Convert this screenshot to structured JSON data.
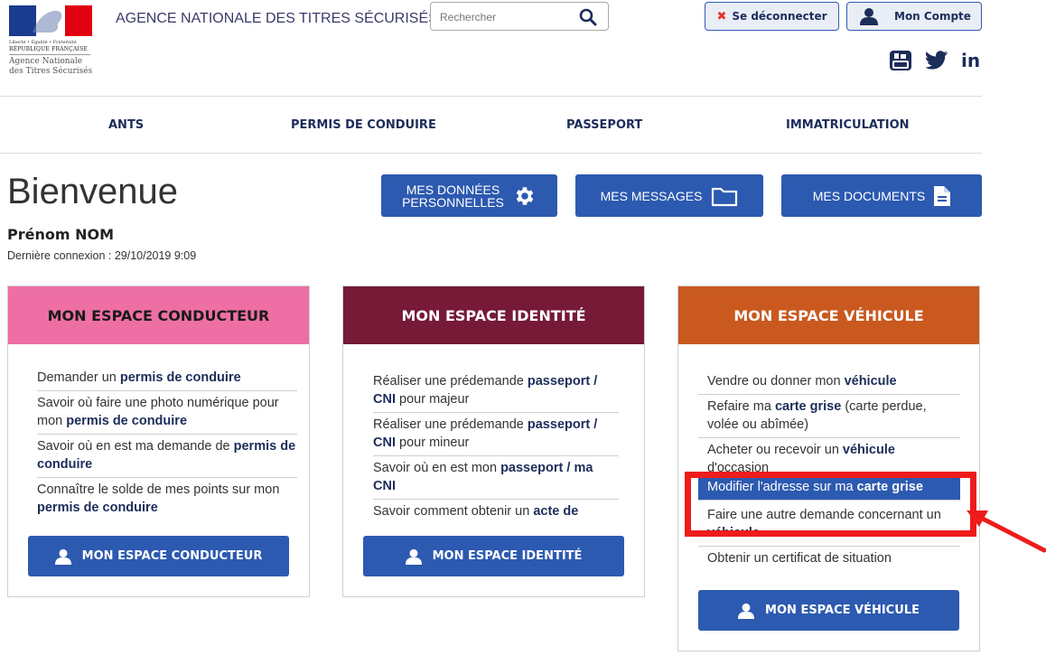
{
  "header": {
    "logo": {
      "motto": "Liberté • Égalité • Fraternité",
      "country": "RÉPUBLIQUE FRANÇAISE",
      "agency_line1": "Agence Nationale",
      "agency_line2": "des Titres Sécurisés"
    },
    "agency_name": "AGENCE NATIONALE DES TITRES SÉCURISÉS",
    "search": {
      "placeholder": "Rechercher"
    },
    "logout_label": "Se déconnecter",
    "account_label": "Mon Compte",
    "social": {
      "linkedin": "in"
    }
  },
  "nav": {
    "items": [
      {
        "label": "ANTS"
      },
      {
        "label": "PERMIS DE CONDUIRE"
      },
      {
        "label": "PASSEPORT"
      },
      {
        "label": "IMMATRICULATION"
      }
    ]
  },
  "welcome": {
    "title": "Bienvenue",
    "user_name": "Prénom NOM",
    "last_login": "Dernière connexion : 29/10/2019 9:09"
  },
  "quick_buttons": {
    "personal_data_line1": "MES DONNÉES",
    "personal_data_line2": "PERSONNELLES",
    "messages": "MES MESSAGES",
    "documents": "MES DOCUMENTS"
  },
  "panels": {
    "conducteur": {
      "title": "MON ESPACE CONDUCTEUR",
      "header_color": "#ee6fa4",
      "items": [
        {
          "pre": "Demander un ",
          "bold": "permis de conduire",
          "post": ""
        },
        {
          "pre": "Savoir où faire une photo numérique pour mon ",
          "bold": "permis de conduire",
          "post": ""
        },
        {
          "pre": "Savoir où en est ma demande de ",
          "bold": "permis de conduire",
          "post": ""
        },
        {
          "pre": "Connaître le solde de mes points sur mon ",
          "bold": "permis de conduire",
          "post": ""
        }
      ],
      "button": "MON ESPACE CONDUCTEUR"
    },
    "identite": {
      "title": "MON ESPACE IDENTITÉ",
      "header_color": "#761a37",
      "items": [
        {
          "pre": "Réaliser une prédemande ",
          "bold": "passeport / CNI",
          "post": " pour majeur"
        },
        {
          "pre": "Réaliser une prédemande ",
          "bold": "passeport / CNI",
          "post": " pour mineur"
        },
        {
          "pre": "Savoir où en est mon ",
          "bold": "passeport / ma CNI",
          "post": ""
        },
        {
          "pre": "Savoir comment obtenir un ",
          "bold": "acte de",
          "post": ""
        }
      ],
      "button": "MON ESPACE IDENTITÉ"
    },
    "vehicule": {
      "title": "MON ESPACE VÉHICULE",
      "header_color": "#c9591f",
      "items": [
        {
          "pre": "Vendre ou donner mon ",
          "bold": "véhicule",
          "post": ""
        },
        {
          "pre": "Refaire ma ",
          "bold": "carte grise",
          "post": " (carte perdue, volée ou abîmée)"
        },
        {
          "pre": "Acheter ou recevoir un ",
          "bold": "véhicule",
          "post": " d'occasion"
        },
        {
          "pre": "Modifier l'adresse sur ma ",
          "bold": "carte grise",
          "post": "",
          "highlight": true
        },
        {
          "pre": "Faire une autre demande concernant un ",
          "bold": "véhicule",
          "post": ""
        },
        {
          "pre": "Obtenir un certificat de situation",
          "bold": "",
          "post": ""
        }
      ],
      "button": "MON ESPACE VÉHICULE"
    }
  },
  "colors": {
    "primary": "#2c5ab0",
    "navy": "#1c2d5a",
    "annotation_red": "#ee1c1c"
  }
}
